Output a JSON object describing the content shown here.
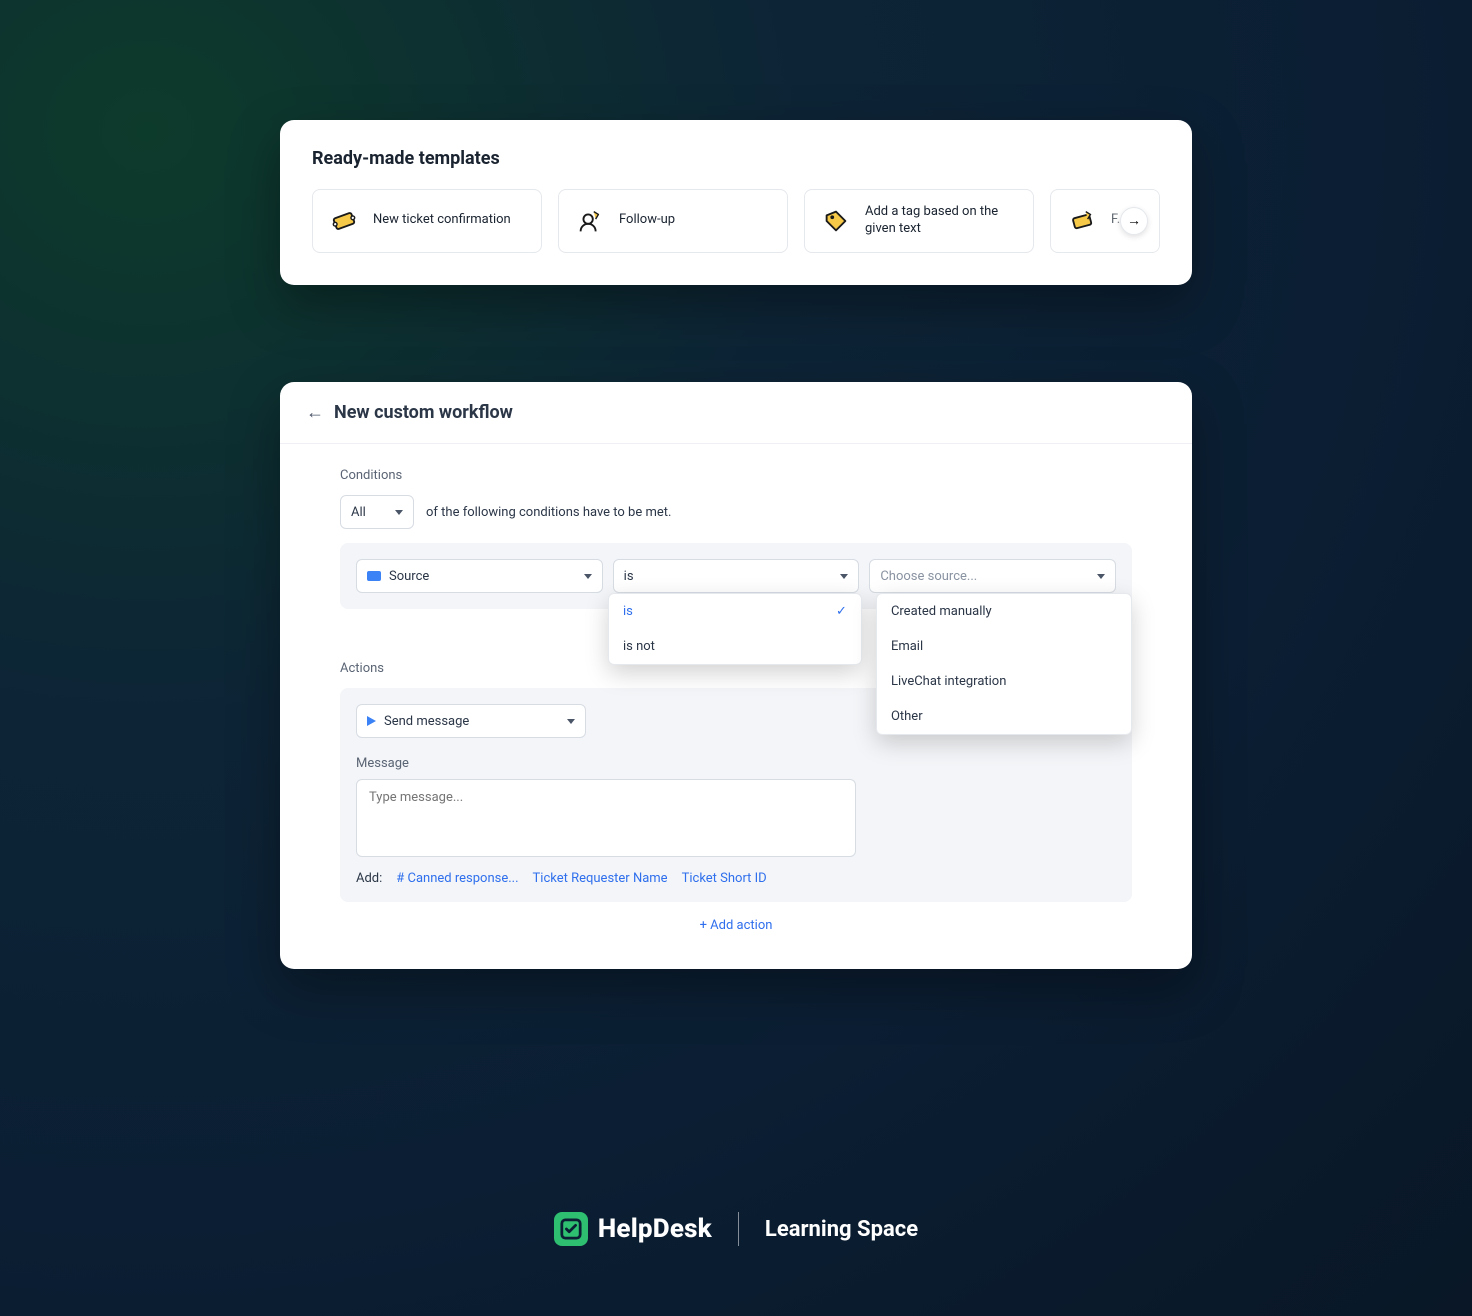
{
  "templates": {
    "heading": "Ready-made templates",
    "items": [
      {
        "label": "New ticket confirmation",
        "icon": "ticket-icon"
      },
      {
        "label": "Follow-up",
        "icon": "person-arrow-icon"
      },
      {
        "label": "Add a tag based on the given text",
        "icon": "tag-icon"
      },
      {
        "label": "F…ba",
        "icon": "ticket-arrow-icon"
      }
    ]
  },
  "workflow": {
    "title": "New custom workflow",
    "conditions": {
      "section_label": "Conditions",
      "match": {
        "selected": "All",
        "suffix": "of the following conditions have to be met."
      },
      "row": {
        "field_label": "Source",
        "operator_selected": "is",
        "operator_options": [
          "is",
          "is not"
        ],
        "value_placeholder": "Choose source...",
        "value_options": [
          "Created manually",
          "Email",
          "LiveChat integration",
          "Other"
        ]
      }
    },
    "actions": {
      "section_label": "Actions",
      "selected_action": "Send message",
      "message_label": "Message",
      "message_placeholder": "Type message...",
      "add_label": "Add:",
      "add_links": [
        "# Canned response...",
        "Ticket Requester Name",
        "Ticket Short ID"
      ],
      "add_action_label": "+ Add action"
    }
  },
  "footer": {
    "brand": "HelpDesk",
    "section": "Learning Space"
  }
}
